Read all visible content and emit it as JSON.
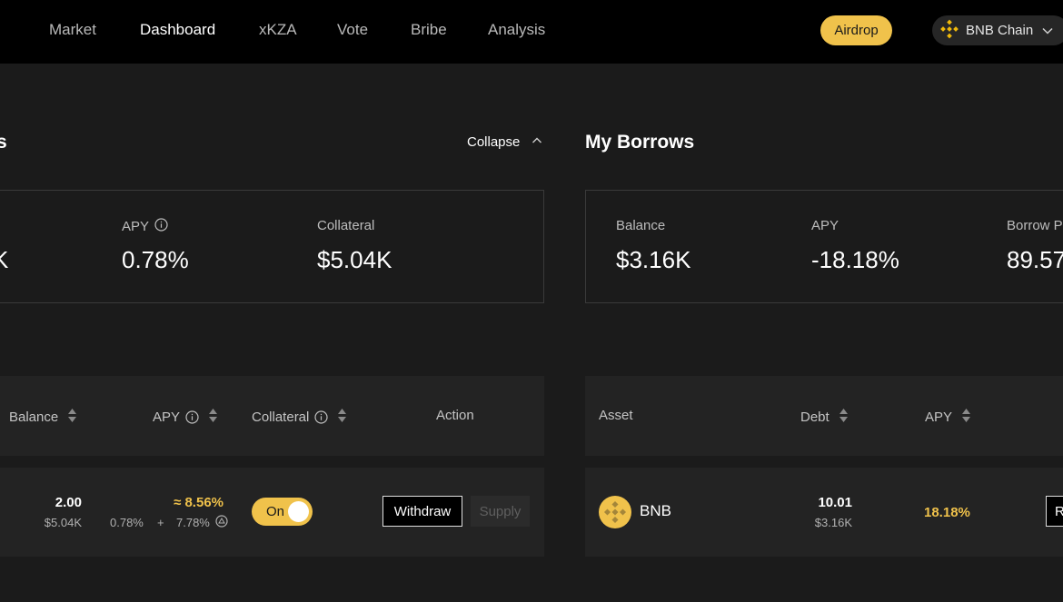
{
  "nav": {
    "items": [
      "Market",
      "Dashboard",
      "xKZA",
      "Vote",
      "Bribe",
      "Analysis"
    ],
    "active": "Dashboard",
    "airdrop_label": "Airdrop",
    "chain_label": "BNB Chain"
  },
  "supplies": {
    "title_visible": "s",
    "collapse_label": "Collapse",
    "summary": {
      "partial_value": "K",
      "apy_label": "APY",
      "apy_value": "0.78%",
      "collateral_label": "Collateral",
      "collateral_value": "$5.04K"
    },
    "columns": [
      "Balance",
      "APY",
      "Collateral",
      "Action"
    ],
    "row": {
      "balance": "2.00",
      "balance_usd": "$5.04K",
      "apy_total": "≈ 8.56%",
      "apy_base": "0.78%",
      "apy_plus": "+",
      "apy_reward": "7.78%",
      "collateral_toggle": "On",
      "withdraw_label": "Withdraw",
      "supply_label": "Supply"
    }
  },
  "borrows": {
    "title": "My Borrows",
    "summary": {
      "balance_label": "Balance",
      "balance_value": "$3.16K",
      "apy_label": "APY",
      "apy_value": "-18.18%",
      "borrow_power_label": "Borrow P",
      "borrow_power_value": "89.57"
    },
    "columns": [
      "Asset",
      "Debt",
      "APY"
    ],
    "row": {
      "asset": "BNB",
      "debt": "10.01",
      "debt_usd": "$3.16K",
      "apy": "18.18%",
      "repay_label": "R"
    }
  },
  "colors": {
    "accent": "#f0c24b",
    "background": "#1b1b1b",
    "panel": "#232323",
    "topbar": "#000000"
  }
}
